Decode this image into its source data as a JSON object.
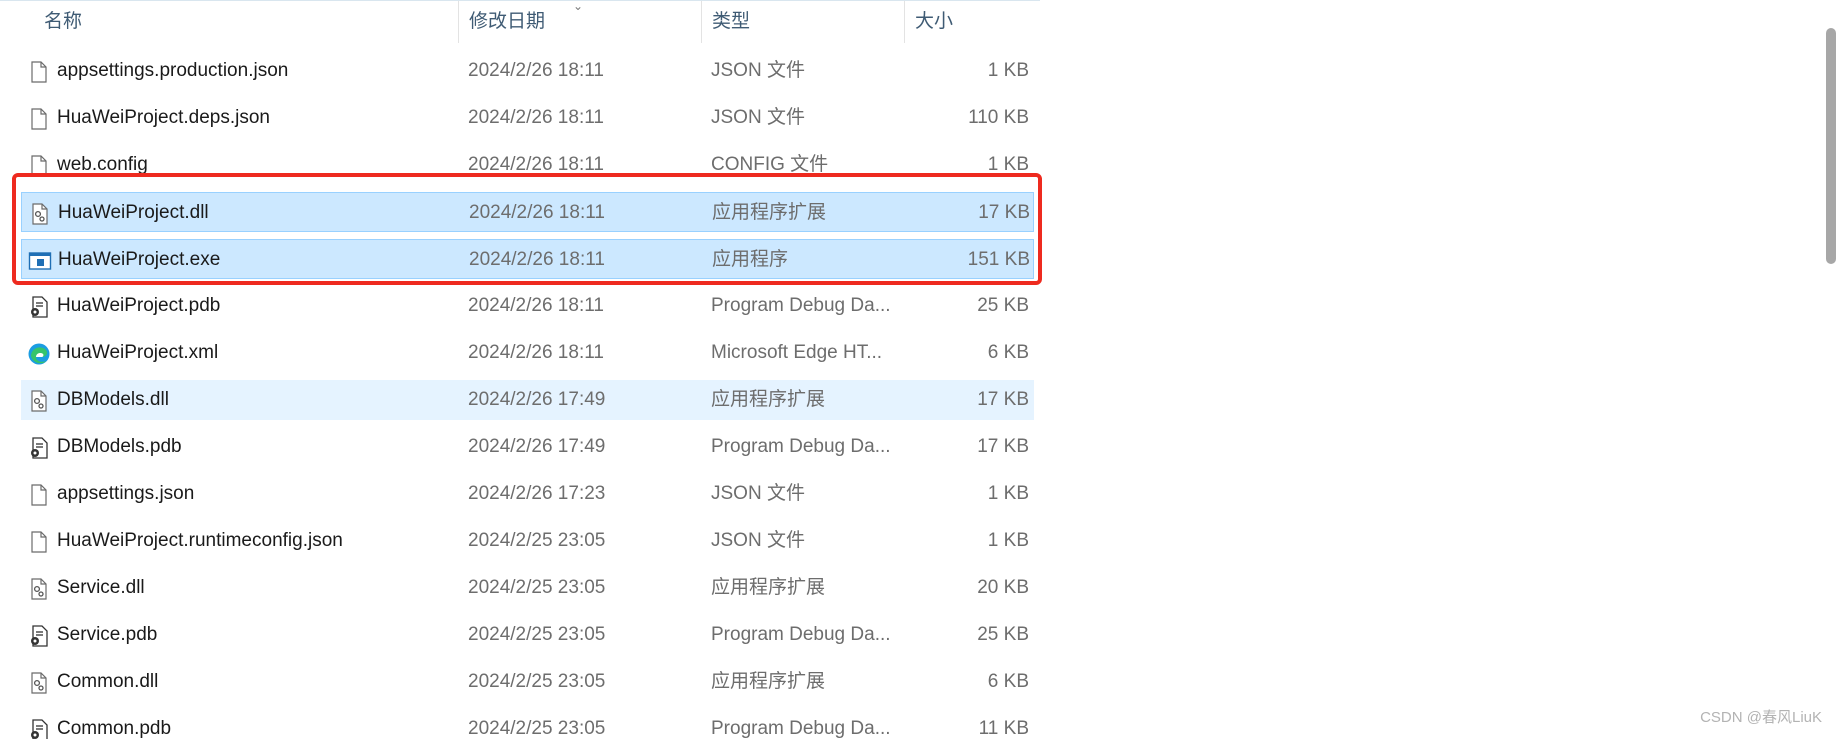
{
  "columns": {
    "name": "名称",
    "date": "修改日期",
    "type": "类型",
    "size": "大小"
  },
  "colors": {
    "selection": "#cce8ff",
    "hover": "#e5f3ff",
    "highlight_box": "#ee2a1f",
    "header_text": "#3f5b74"
  },
  "files": [
    {
      "name": "appsettings.production.json",
      "date": "2024/2/26 18:11",
      "type": "JSON 文件",
      "size": "1 KB",
      "icon": "generic-file-icon",
      "state": "normal"
    },
    {
      "name": "HuaWeiProject.deps.json",
      "date": "2024/2/26 18:11",
      "type": "JSON 文件",
      "size": "110 KB",
      "icon": "generic-file-icon",
      "state": "normal"
    },
    {
      "name": "web.config",
      "date": "2024/2/26 18:11",
      "type": "CONFIG 文件",
      "size": "1 KB",
      "icon": "generic-file-icon",
      "state": "normal"
    },
    {
      "name": "HuaWeiProject.dll",
      "date": "2024/2/26 18:11",
      "type": "应用程序扩展",
      "size": "17 KB",
      "icon": "dll-gear-file-icon",
      "state": "selected"
    },
    {
      "name": "HuaWeiProject.exe",
      "date": "2024/2/26 18:11",
      "type": "应用程序",
      "size": "151 KB",
      "icon": "exe-window-icon",
      "state": "selected"
    },
    {
      "name": "HuaWeiProject.pdb",
      "date": "2024/2/26 18:11",
      "type": "Program Debug Da...",
      "size": "25 KB",
      "icon": "pdb-file-icon",
      "state": "normal"
    },
    {
      "name": "HuaWeiProject.xml",
      "date": "2024/2/26 18:11",
      "type": "Microsoft Edge HT...",
      "size": "6 KB",
      "icon": "edge-icon",
      "state": "normal"
    },
    {
      "name": "DBModels.dll",
      "date": "2024/2/26 17:49",
      "type": "应用程序扩展",
      "size": "17 KB",
      "icon": "dll-gear-file-icon",
      "state": "hover"
    },
    {
      "name": "DBModels.pdb",
      "date": "2024/2/26 17:49",
      "type": "Program Debug Da...",
      "size": "17 KB",
      "icon": "pdb-file-icon",
      "state": "normal"
    },
    {
      "name": "appsettings.json",
      "date": "2024/2/26 17:23",
      "type": "JSON 文件",
      "size": "1 KB",
      "icon": "generic-file-icon",
      "state": "normal"
    },
    {
      "name": "HuaWeiProject.runtimeconfig.json",
      "date": "2024/2/25 23:05",
      "type": "JSON 文件",
      "size": "1 KB",
      "icon": "generic-file-icon",
      "state": "normal"
    },
    {
      "name": "Service.dll",
      "date": "2024/2/25 23:05",
      "type": "应用程序扩展",
      "size": "20 KB",
      "icon": "dll-gear-file-icon",
      "state": "normal"
    },
    {
      "name": "Service.pdb",
      "date": "2024/2/25 23:05",
      "type": "Program Debug Da...",
      "size": "25 KB",
      "icon": "pdb-file-icon",
      "state": "normal"
    },
    {
      "name": "Common.dll",
      "date": "2024/2/25 23:05",
      "type": "应用程序扩展",
      "size": "6 KB",
      "icon": "dll-gear-file-icon",
      "state": "normal"
    },
    {
      "name": "Common.pdb",
      "date": "2024/2/25 23:05",
      "type": "Program Debug Da...",
      "size": "11 KB",
      "icon": "pdb-file-icon",
      "state": "normal"
    }
  ],
  "watermark": "CSDN @春风LiuK"
}
